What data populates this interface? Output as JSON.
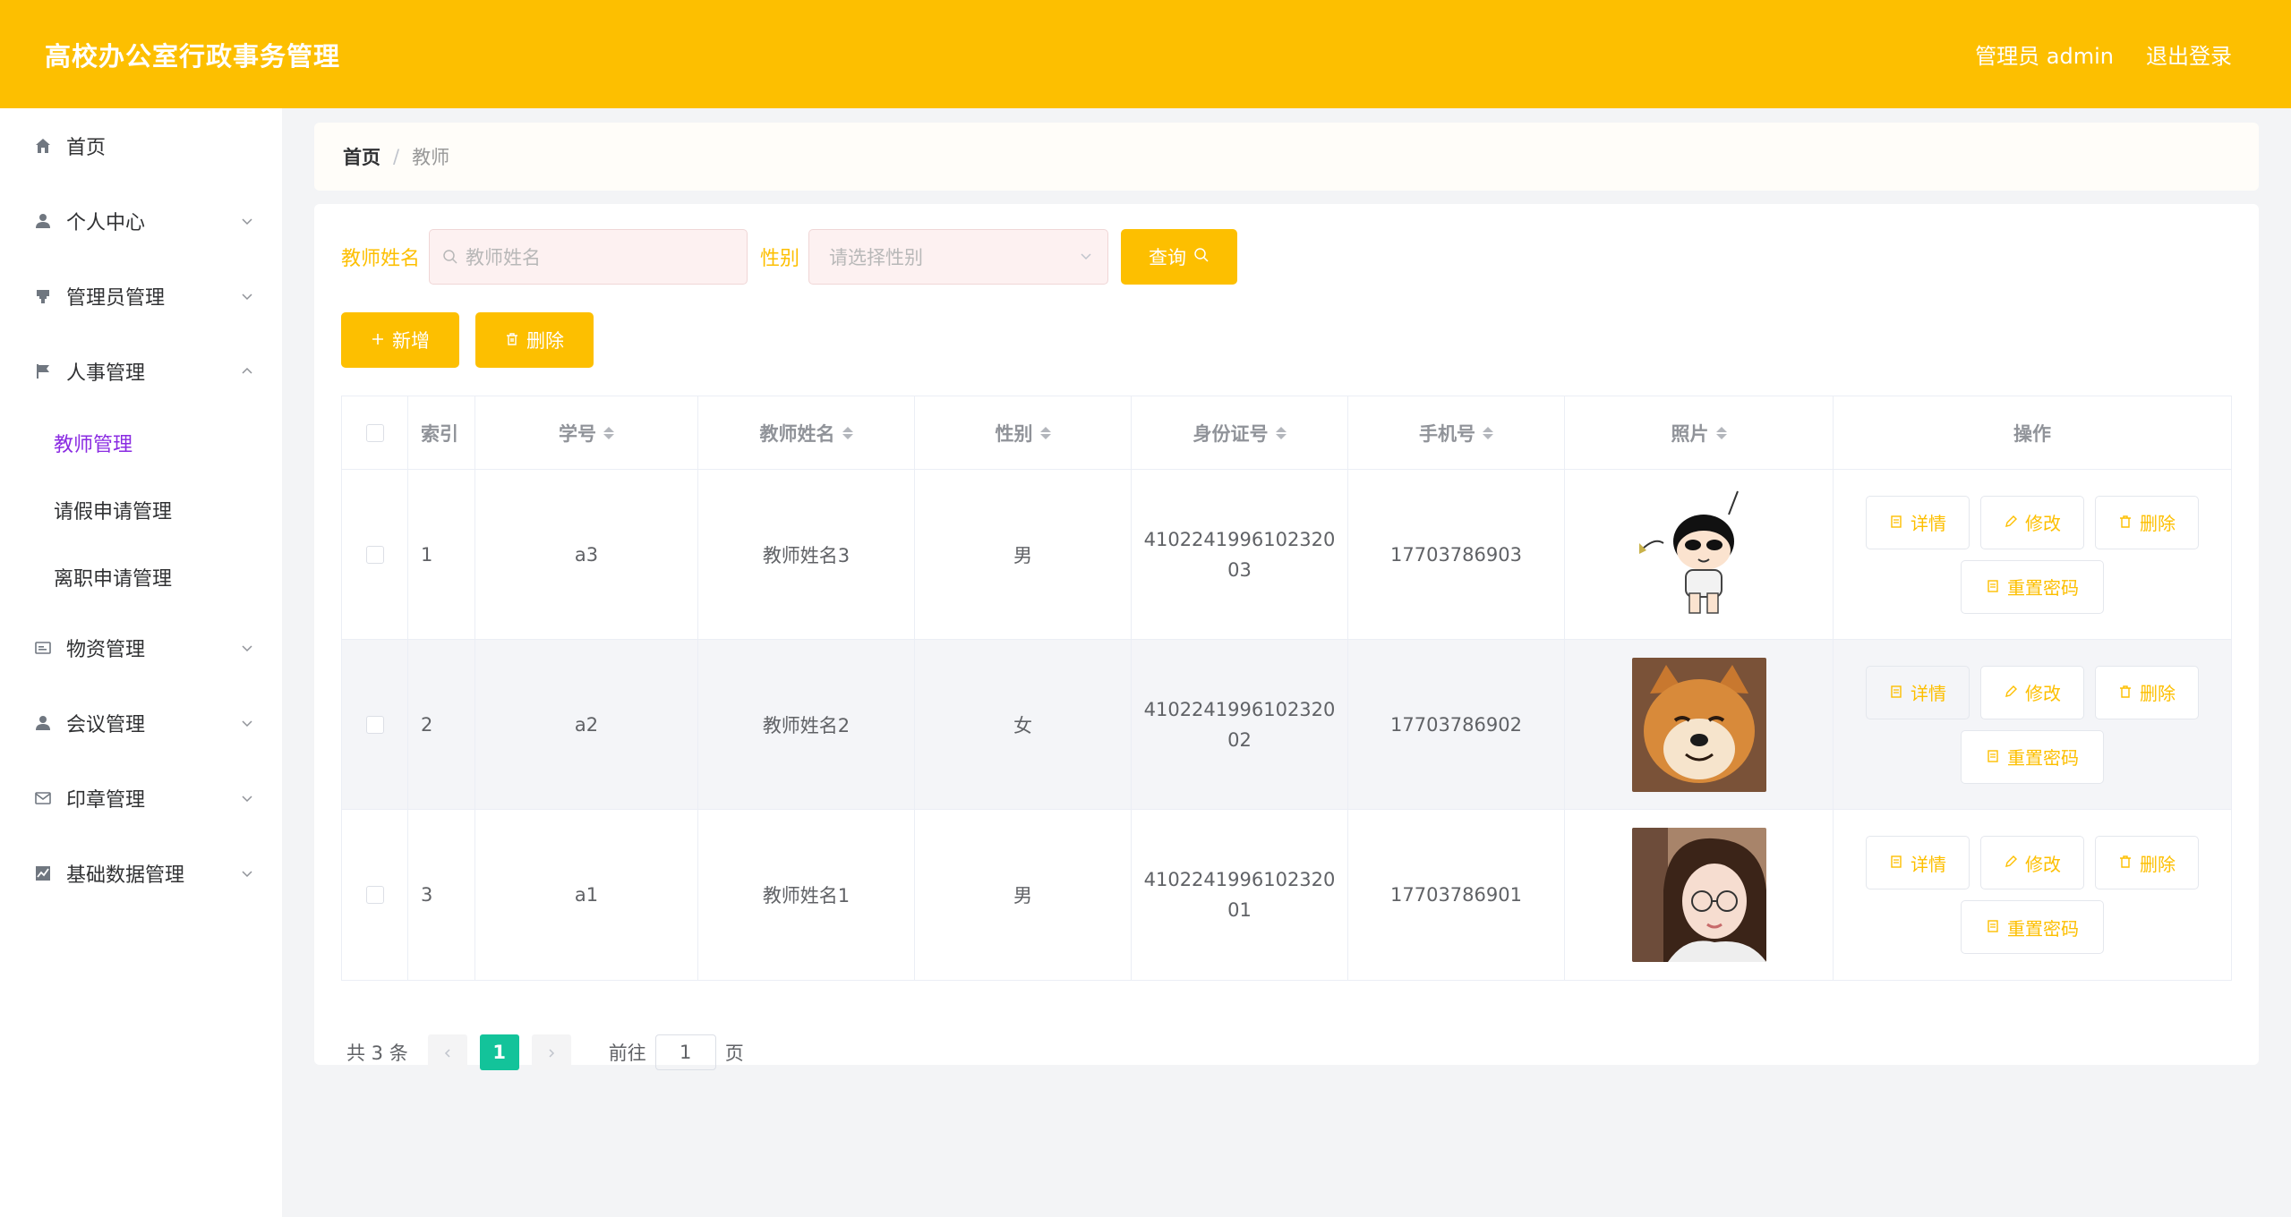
{
  "header": {
    "title": "高校办公室行政事务管理",
    "user_label": "管理员 admin",
    "logout_label": "退出登录",
    "accent_color": "#fdbf00"
  },
  "sidebar": {
    "items": [
      {
        "label": "首页",
        "icon": "home-icon"
      },
      {
        "label": "个人中心",
        "icon": "user-icon"
      },
      {
        "label": "管理员管理",
        "icon": "stamp-icon"
      },
      {
        "label": "人事管理",
        "icon": "flag-icon"
      },
      {
        "label": "物资管理",
        "icon": "tag-icon"
      },
      {
        "label": "会议管理",
        "icon": "user-icon"
      },
      {
        "label": "印章管理",
        "icon": "mail-icon"
      },
      {
        "label": "基础数据管理",
        "icon": "chart-icon"
      }
    ],
    "subitems": [
      {
        "label": "教师管理",
        "active": true
      },
      {
        "label": "请假申请管理",
        "active": false
      },
      {
        "label": "离职申请管理",
        "active": false
      }
    ]
  },
  "breadcrumb": {
    "home": "首页",
    "separator": "/",
    "current": "教师"
  },
  "search": {
    "name_label": "教师姓名",
    "name_placeholder": "教师姓名",
    "sex_label": "性别",
    "sex_placeholder": "请选择性别",
    "query_label": "查询"
  },
  "actions": {
    "add_label": "新增",
    "delete_label": "删除"
  },
  "table": {
    "columns": [
      "索引",
      "学号",
      "教师姓名",
      "性别",
      "身份证号",
      "手机号",
      "照片",
      "操作"
    ],
    "rows": [
      {
        "index": "1",
        "no": "a3",
        "name": "教师姓名3",
        "sex": "男",
        "id_card": "410224199610232003",
        "phone": "17703786903",
        "photo": "cartoon-boy-photo"
      },
      {
        "index": "2",
        "no": "a2",
        "name": "教师姓名2",
        "sex": "女",
        "id_card": "410224199610232002",
        "phone": "17703786902",
        "photo": "shiba-dog-photo"
      },
      {
        "index": "3",
        "no": "a1",
        "name": "教师姓名1",
        "sex": "男",
        "id_card": "410224199610232001",
        "phone": "17703786901",
        "photo": "girl-glasses-photo"
      }
    ],
    "op_labels": {
      "detail": "详情",
      "edit": "修改",
      "delete": "删除",
      "reset": "重置密码"
    }
  },
  "pagination": {
    "total_text": "共 3 条",
    "current_page": "1",
    "goto_label": "前往",
    "goto_value": "1",
    "page_suffix": "页"
  }
}
